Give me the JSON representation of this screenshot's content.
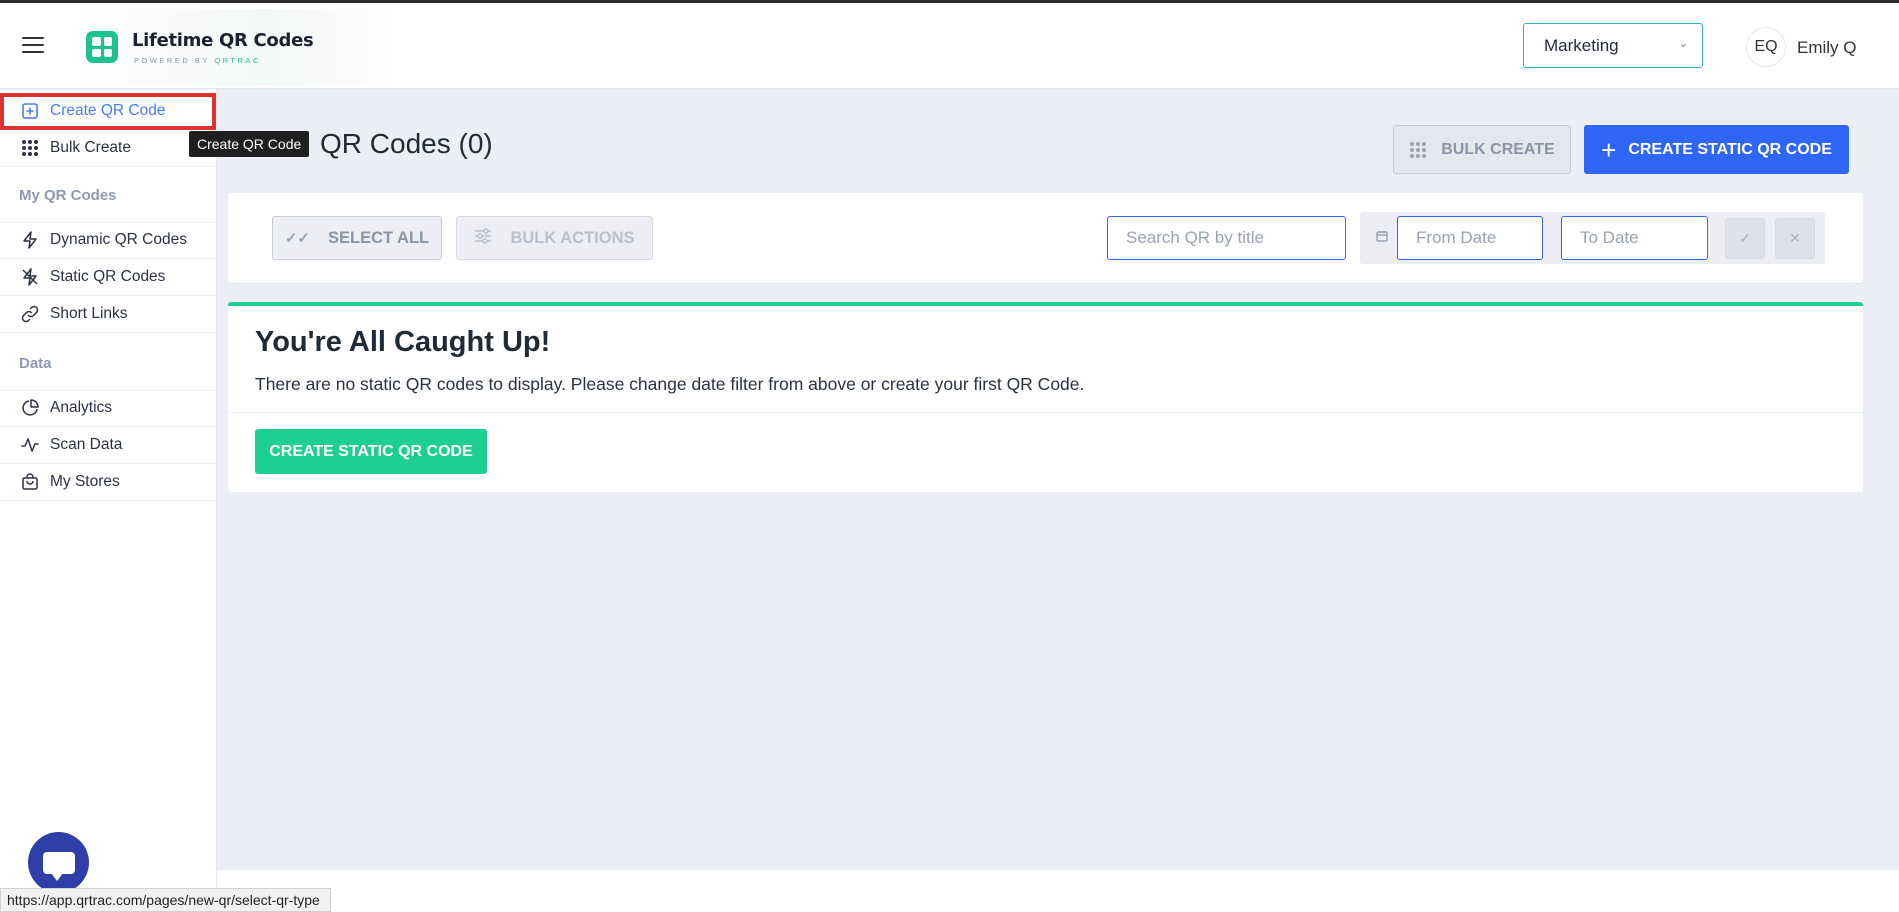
{
  "header": {
    "logo_title": "Lifetime QR Codes",
    "logo_sub_prefix": "POWERED BY",
    "logo_sub_brand": "QRTRAC",
    "workspace": "Marketing",
    "avatar_initials": "EQ",
    "user_name": "Emily Q"
  },
  "sidebar": {
    "create_qr_code": "Create QR Code",
    "bulk_create": "Bulk Create",
    "section_my_qr": "My QR Codes",
    "dynamic_qr_codes": "Dynamic QR Codes",
    "static_qr_codes": "Static QR Codes",
    "short_links": "Short Links",
    "section_data": "Data",
    "analytics": "Analytics",
    "scan_data": "Scan Data",
    "my_stores": "My Stores"
  },
  "tooltip": "Create QR Code",
  "main": {
    "page_title": "QR Codes (0)",
    "bulk_create_btn": "BULK CREATE",
    "create_static_btn": "CREATE STATIC QR CODE",
    "select_all": "SELECT ALL",
    "bulk_actions": "BULK ACTIONS",
    "search_placeholder": "Search QR by title",
    "from_date_placeholder": "From Date",
    "to_date_placeholder": "To Date",
    "empty_title": "You're All Caught Up!",
    "empty_text": "There are no static QR codes to display. Please change date filter from above or create your first QR Code.",
    "empty_create_btn": "CREATE STATIC QR CODE"
  },
  "status_url": "https://app.qrtrac.com/pages/new-qr/select-qr-type",
  "colors": {
    "primary_blue": "#2f66f6",
    "accent_green": "#1ecf92",
    "highlight_red": "#e03131",
    "background": "#ebeef5"
  }
}
